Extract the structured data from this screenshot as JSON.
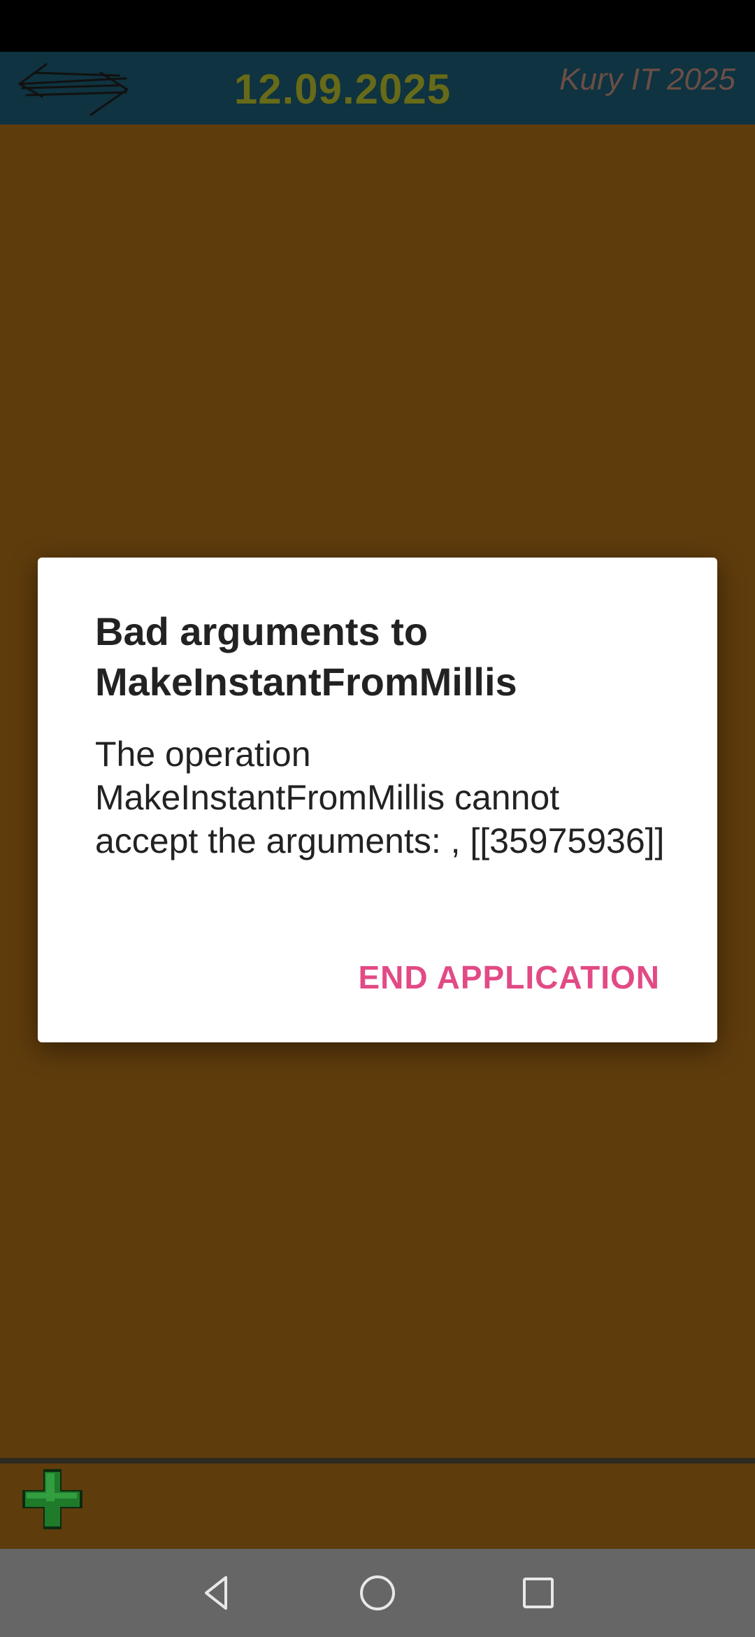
{
  "header": {
    "date": "12.09.2025",
    "brand": "Kury IT 2025",
    "swap_icon": "swap-arrows-icon"
  },
  "dialog": {
    "title": "Bad arguments to MakeInstantFromMillis",
    "message": "The operation MakeInstantFromMillis cannot accept the arguments: , [[35975936]]",
    "action_label": "END APPLICATION"
  },
  "bottom": {
    "add_icon": "green-plus-icon"
  },
  "nav": {
    "back_icon": "back-triangle-icon",
    "home_icon": "home-circle-icon",
    "recents_icon": "recents-square-icon"
  },
  "colors": {
    "background": "#5f3c0c",
    "header": "#0f3340",
    "date_text": "#676a18",
    "brand_text": "#6b4e46",
    "accent": "#e24a86",
    "nav_bar": "#666666"
  }
}
